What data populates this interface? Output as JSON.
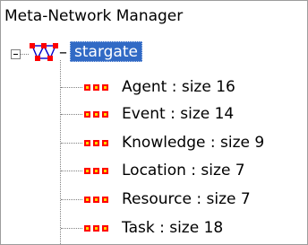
{
  "window": {
    "title": "Meta-Network Manager"
  },
  "tree": {
    "root": {
      "label": "stargate",
      "icon": "network-graph-icon",
      "expanded": true
    },
    "nodes": [
      {
        "label": "Agent : size 16",
        "icon": "nodeset-icon"
      },
      {
        "label": "Event : size 14",
        "icon": "nodeset-icon"
      },
      {
        "label": "Knowledge : size 9",
        "icon": "nodeset-icon"
      },
      {
        "label": "Location : size 7",
        "icon": "nodeset-icon"
      },
      {
        "label": "Resource : size 7",
        "icon": "nodeset-icon"
      },
      {
        "label": "Task : size 18",
        "icon": "nodeset-icon"
      }
    ]
  },
  "colors": {
    "selection": "#316ac5",
    "icon_border": "#ff0000",
    "icon_fill": "#ffd800",
    "graph_node": "#ff0000",
    "graph_edge": "#0000cc"
  }
}
